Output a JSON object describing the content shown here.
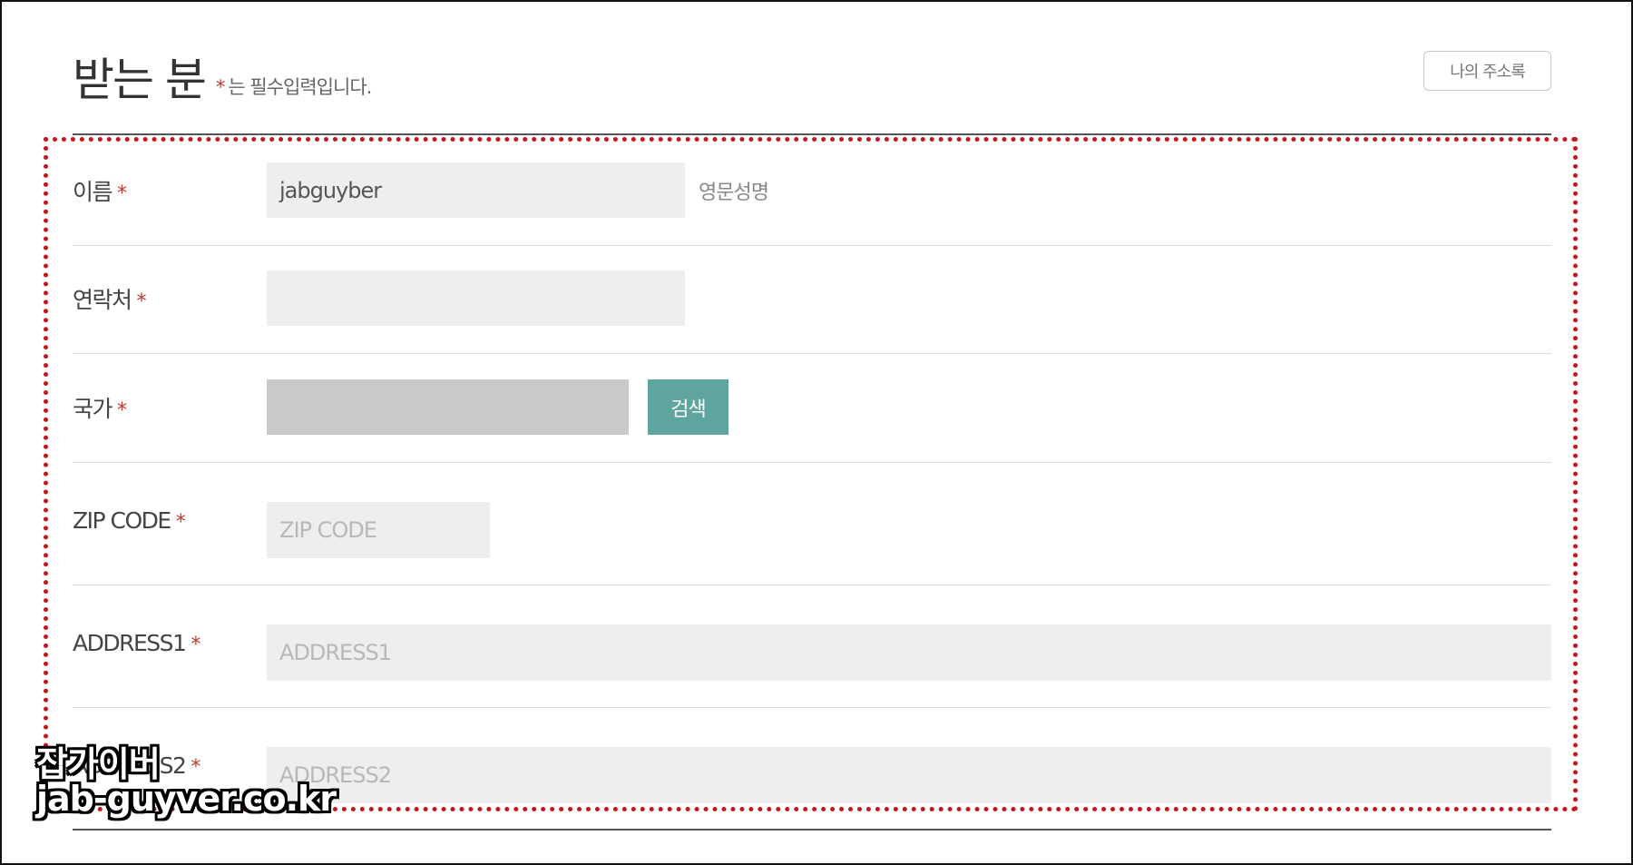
{
  "header": {
    "title": "받는 분",
    "required_star": "*",
    "required_note": "는 필수입력입니다.",
    "address_book_label": "나의 주소록"
  },
  "form": {
    "name": {
      "label": "이름",
      "star": "*",
      "value": "jabguyber",
      "hint": "영문성명"
    },
    "phone": {
      "label": "연락처",
      "star": "*",
      "value": ""
    },
    "country": {
      "label": "국가",
      "star": "*",
      "value": "",
      "search_label": "검색"
    },
    "zip": {
      "label": "ZIP CODE",
      "star": "*",
      "placeholder": "ZIP CODE"
    },
    "address1": {
      "label": "ADDRESS1",
      "star": "*",
      "placeholder": "ADDRESS1"
    },
    "address2": {
      "label": "ADDRESS2",
      "star": "*",
      "placeholder": "ADDRESS2"
    }
  },
  "watermark": {
    "line1": "잡가이버",
    "line2": "jab-guyver.co.kr"
  },
  "colors": {
    "accent_button": "#5da59e",
    "required_star": "#c0392b",
    "highlight_box": "#c4161c",
    "field_background": "#eeeeee",
    "disabled_field": "#c9c9c9"
  }
}
